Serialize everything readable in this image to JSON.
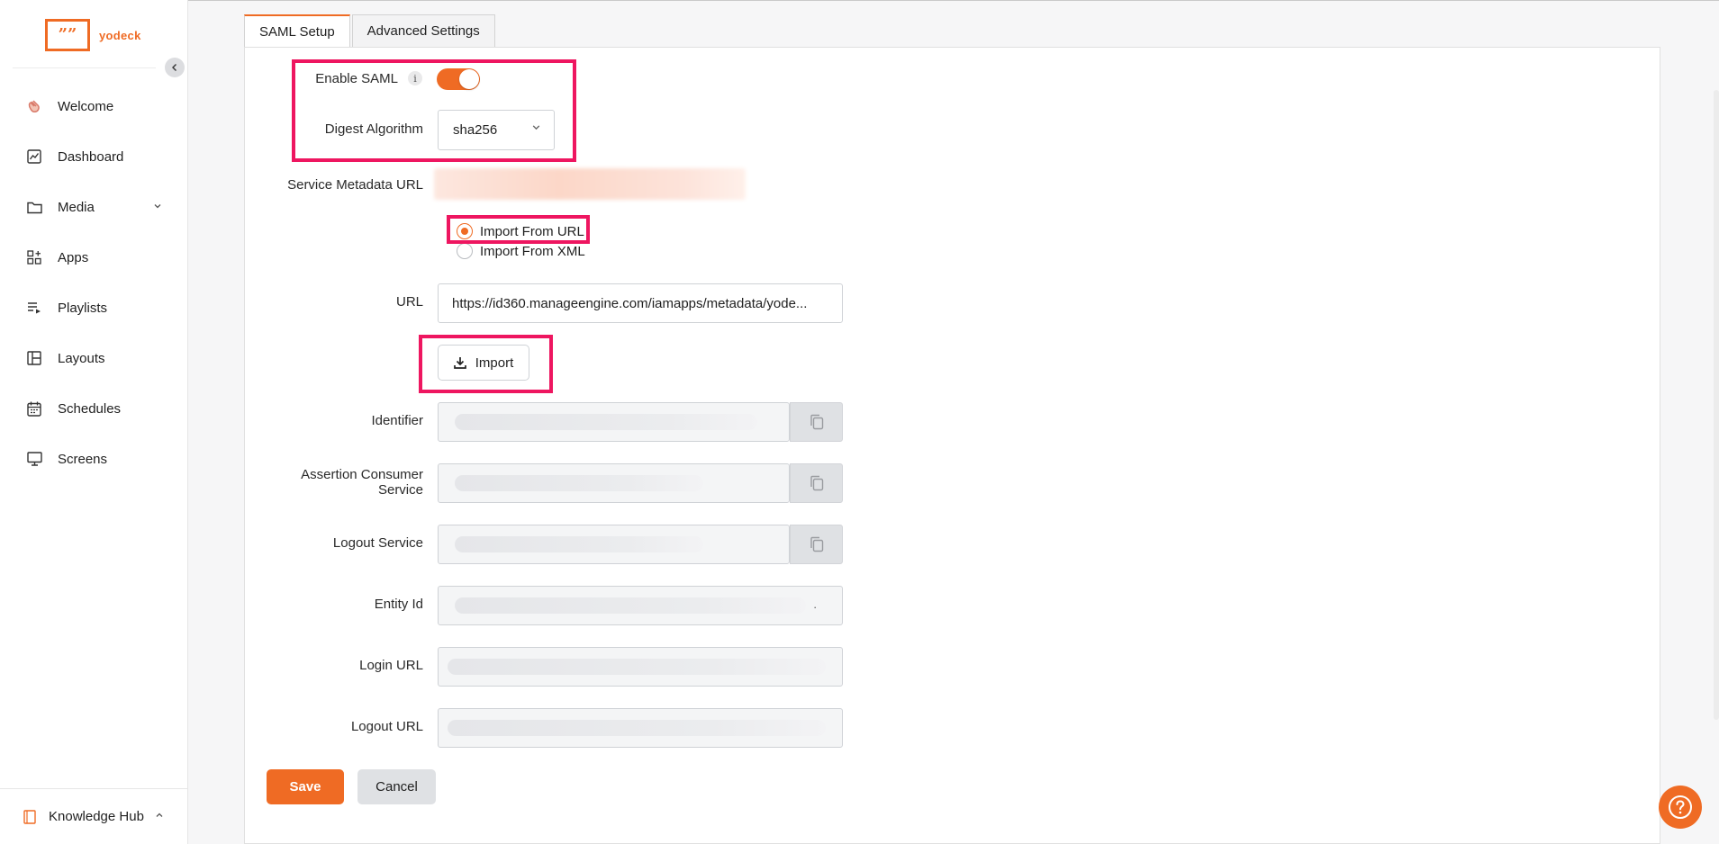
{
  "sidebar": {
    "logo_text": "yodeck",
    "logo_mark": "”",
    "items": [
      {
        "label": "Welcome",
        "icon": "hand-wave-icon"
      },
      {
        "label": "Dashboard",
        "icon": "chart-icon"
      },
      {
        "label": "Media",
        "icon": "folder-icon"
      },
      {
        "label": "Apps",
        "icon": "apps-grid-icon"
      },
      {
        "label": "Playlists",
        "icon": "playlist-icon"
      },
      {
        "label": "Layouts",
        "icon": "layout-icon"
      },
      {
        "label": "Schedules",
        "icon": "calendar-icon"
      },
      {
        "label": "Screens",
        "icon": "monitor-icon"
      }
    ],
    "bottom": {
      "label": "Knowledge Hub",
      "icon": "book-icon"
    }
  },
  "tabs": [
    {
      "label": "SAML Setup",
      "active": true
    },
    {
      "label": "Advanced Settings",
      "active": false
    }
  ],
  "form": {
    "enable_saml_label": "Enable SAML",
    "enable_saml_on": true,
    "digest_label": "Digest Algorithm",
    "digest_value": "sha256",
    "service_metadata_label": "Service Metadata URL",
    "import_from_url_label": "Import From URL",
    "import_from_xml_label": "Import From XML",
    "url_label": "URL",
    "url_value": "https://id360.manageengine.com/iamapps/metadata/yode...",
    "import_button": "Import",
    "identifier_label": "Identifier",
    "acs_label": "Assertion Consumer Service",
    "logout_service_label": "Logout Service",
    "entity_id_label": "Entity Id",
    "entity_id_suffix": ".",
    "login_url_label": "Login URL",
    "logout_url_label": "Logout URL",
    "save_button": "Save",
    "cancel_button": "Cancel"
  },
  "colors": {
    "accent": "#ef6b24",
    "highlight": "#ee1660"
  }
}
